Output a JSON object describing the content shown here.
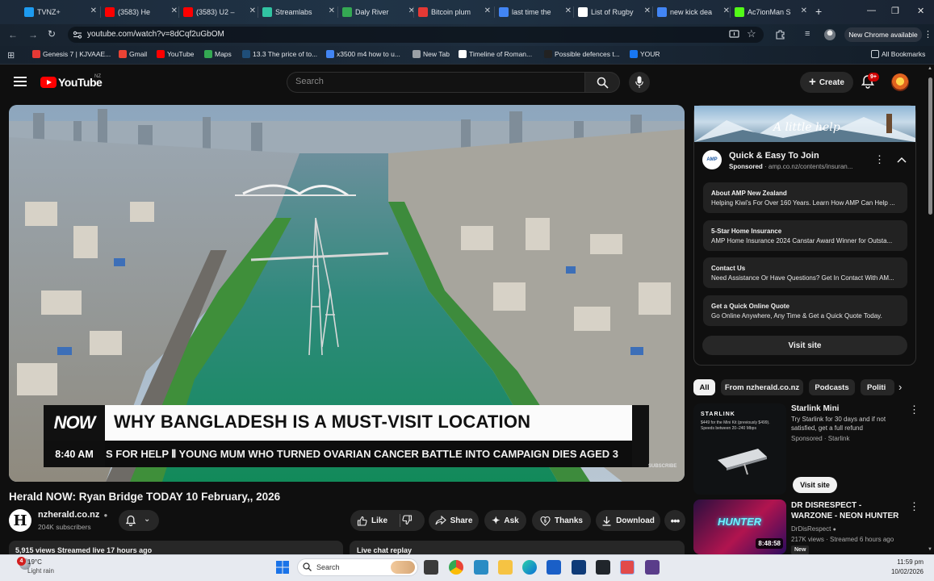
{
  "browser": {
    "tabs": [
      {
        "label": "TVNZ+",
        "color": "#1d9bf0"
      },
      {
        "label": "(3583) He",
        "color": "#ff0000"
      },
      {
        "label": "(3583) U2 –",
        "color": "#ff0000"
      },
      {
        "label": "Streamlabs",
        "color": "#31c3a2"
      },
      {
        "label": "Daly River",
        "color": "#34a853"
      },
      {
        "label": "Bitcoin plum",
        "color": "#e53935"
      },
      {
        "label": "last time the",
        "color": "#4285f4"
      },
      {
        "label": "List of Rugby",
        "color": "#ffffff"
      },
      {
        "label": "new kick dea",
        "color": "#4285f4"
      },
      {
        "label": "Ac7ionMan S",
        "color": "#53fc18"
      }
    ],
    "url": "youtube.com/watch?v=8dCqf2uGbOM",
    "new_chrome_label": "New Chrome available",
    "bookmarks": [
      {
        "label": "Genesis 7 | KJVAAE...",
        "color": "#e53935"
      },
      {
        "label": "Gmail",
        "color": "#ea4335"
      },
      {
        "label": "YouTube",
        "color": "#ff0000"
      },
      {
        "label": "Maps",
        "color": "#34a853"
      },
      {
        "label": "13.3 The price of to...",
        "color": "#1f4e79"
      },
      {
        "label": "x3500 m4 how to u...",
        "color": "#4285f4"
      },
      {
        "label": "New Tab",
        "color": "#9aa0a6"
      },
      {
        "label": "Timeline of Roman...",
        "color": "#ffffff"
      },
      {
        "label": "Possible defences t...",
        "color": "#222222"
      },
      {
        "label": "YOUR",
        "color": "#1877f2"
      }
    ],
    "all_bookmarks_label": "All Bookmarks"
  },
  "youtube": {
    "logo_text": "YouTube",
    "country_code": "NZ",
    "search_placeholder": "Search",
    "create_label": "Create",
    "notification_count": "9+"
  },
  "video": {
    "overlay": {
      "brand": "NOW",
      "headline": "WHY BANGLADESH IS A MUST-VISIT LOCATION",
      "time": "8:40 AM",
      "ticker": "S FOR HELP   ⦀   YOUNG MUM WHO TURNED OVARIAN CANCER BATTLE INTO CAMPAIGN DIES AGED 3",
      "watermark": "SUBSCRIBE"
    },
    "title": "Herald NOW: Ryan Bridge TODAY 10 February,, 2026",
    "channel": {
      "name": "nzherald.co.nz",
      "logo_letter": "H",
      "subscribers": "204K subscribers"
    },
    "actions": {
      "like": "Like",
      "share": "Share",
      "ask": "Ask",
      "thanks": "Thanks",
      "download": "Download"
    },
    "views_line": "5,915 views  Streamed live 17 hours ago",
    "live_chat_label": "Live chat replay"
  },
  "ad": {
    "banner_text": "A little help",
    "logo_text": "AMP",
    "title": "Quick & Easy To Join",
    "sponsored_label": "Sponsored",
    "sponsored_url": "amp.co.nz/contents/insuran...",
    "links": [
      {
        "title": "About AMP New Zealand",
        "desc": "Helping Kiwi's For Over 160 Years. Learn How AMP Can Help ..."
      },
      {
        "title": "5-Star Home Insurance",
        "desc": "AMP Home Insurance 2024 Canstar Award Winner for Outsta..."
      },
      {
        "title": "Contact Us",
        "desc": "Need Assistance Or Have Questions? Get In Contact With AM..."
      },
      {
        "title": "Get a Quick Online Quote",
        "desc": "Go Online Anywhere, Any Time & Get a Quick Quote Today."
      }
    ],
    "visit_site_label": "Visit site"
  },
  "chips": [
    "All",
    "From nzherald.co.nz",
    "Podcasts",
    "Politi"
  ],
  "recommendations": [
    {
      "title": "Starlink Mini",
      "meta1": "Try Starlink for 30 days and if not satisfied, get a full refund",
      "sponsored": "Sponsored · Starlink",
      "thumb_text": "STARLINK",
      "thumb_sub": "$449 for the Mini Kit (previously $499). Speeds between 20–240 Mbps",
      "visit_label": "Visit site"
    },
    {
      "title": "DR DISRESPECT - WARZONE - NEON HUNTER",
      "channel": "DrDisRespect",
      "meta": "217K views · Streamed 6 hours ago",
      "badge": "New",
      "duration": "8:48:58",
      "thumb_text": "HUNTER"
    }
  ],
  "taskbar": {
    "weather_badge": "4",
    "temperature": "19°C",
    "condition": "Light rain",
    "search_label": "Search",
    "time": "11:59 pm",
    "date": "10/02/2026"
  }
}
